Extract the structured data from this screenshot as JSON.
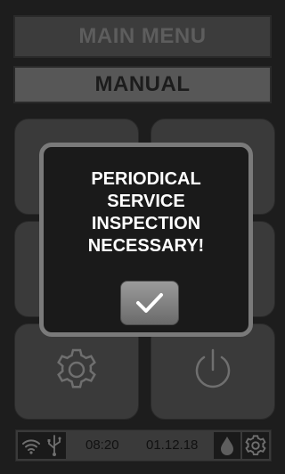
{
  "header": {
    "main_menu_label": "MAIN MENU"
  },
  "mode": {
    "label": "MANUAL"
  },
  "dialog": {
    "lines": [
      "PERIODICAL",
      "SERVICE",
      "INSPECTION",
      "NECESSARY!"
    ],
    "confirm_icon": "check-icon"
  },
  "status_bar": {
    "time": "08:20",
    "date": "01.12.18",
    "icons": [
      "wifi-icon",
      "usb-icon",
      "water-drop-icon",
      "gear-icon"
    ]
  },
  "tiles": {
    "bottom_left_icon": "gear-icon",
    "bottom_right_icon": "power-icon"
  },
  "colors": {
    "background": "#1d1d1d",
    "tile": "#3a3a3a",
    "dialog_border": "#7a7a7a",
    "dialog_text": "#ffffff",
    "button": "#8a8a8a"
  }
}
